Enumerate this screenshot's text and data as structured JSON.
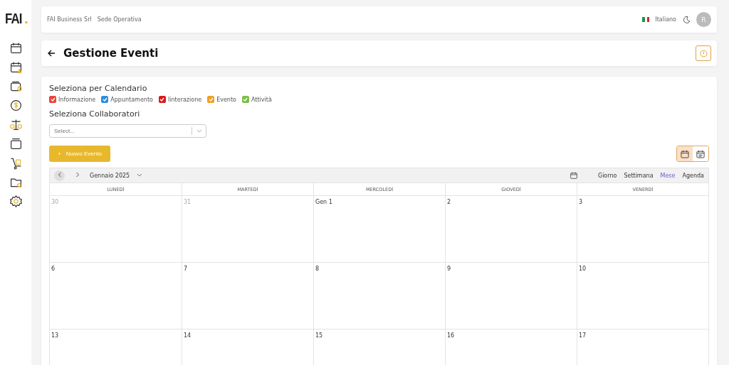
{
  "sidebar": {
    "logo": {
      "text": "FAI",
      "dot": "."
    }
  },
  "header": {
    "company": "FAI Business Srl",
    "location": "Sede Operativa",
    "language": "Italiano",
    "avatar": "R"
  },
  "page": {
    "title": "Gestione Eventi"
  },
  "filters": {
    "title": "Seleziona per Calendario",
    "items": [
      {
        "label": "Informazione",
        "checked": true,
        "color": "#e8453c"
      },
      {
        "label": "Appuntamento",
        "checked": true,
        "color": "#2f8fdc"
      },
      {
        "label": "Iinterazione",
        "checked": true,
        "color": "#d91b1b"
      },
      {
        "label": "Evento",
        "checked": true,
        "color": "#f0a020"
      },
      {
        "label": "Attività",
        "checked": true,
        "color": "#7cbf45"
      }
    ]
  },
  "collaborators": {
    "title": "Seleziona Collaboratori",
    "placeholder": "Select..."
  },
  "new_button": {
    "icon": "+",
    "label": "Nuovo Evento"
  },
  "view_toggle": [
    {
      "selected": true
    },
    {
      "selected": false
    }
  ],
  "calendar": {
    "month": "Gennaio 2025",
    "views": [
      {
        "label": "Giorno",
        "selected": false
      },
      {
        "label": "Settimana",
        "selected": false
      },
      {
        "label": "Mese",
        "selected": true
      },
      {
        "label": "Agenda",
        "selected": false
      }
    ],
    "weekdays": [
      "LUNEDÌ",
      "MARTEDÌ",
      "MERCOLEDÌ",
      "GIOVEDÌ",
      "VENERDÌ"
    ],
    "weeks": [
      [
        {
          "label": "30",
          "in_month": false
        },
        {
          "label": "31",
          "in_month": false
        },
        {
          "label": "Gen 1",
          "in_month": true
        },
        {
          "label": "2",
          "in_month": true
        },
        {
          "label": "3",
          "in_month": true
        }
      ],
      [
        {
          "label": "6",
          "in_month": true
        },
        {
          "label": "7",
          "in_month": true
        },
        {
          "label": "8",
          "in_month": true
        },
        {
          "label": "9",
          "in_month": true
        },
        {
          "label": "10",
          "in_month": true
        }
      ],
      [
        {
          "label": "13",
          "in_month": true
        },
        {
          "label": "14",
          "in_month": true
        },
        {
          "label": "15",
          "in_month": true
        },
        {
          "label": "16",
          "in_month": true
        },
        {
          "label": "17",
          "in_month": true
        }
      ]
    ]
  }
}
